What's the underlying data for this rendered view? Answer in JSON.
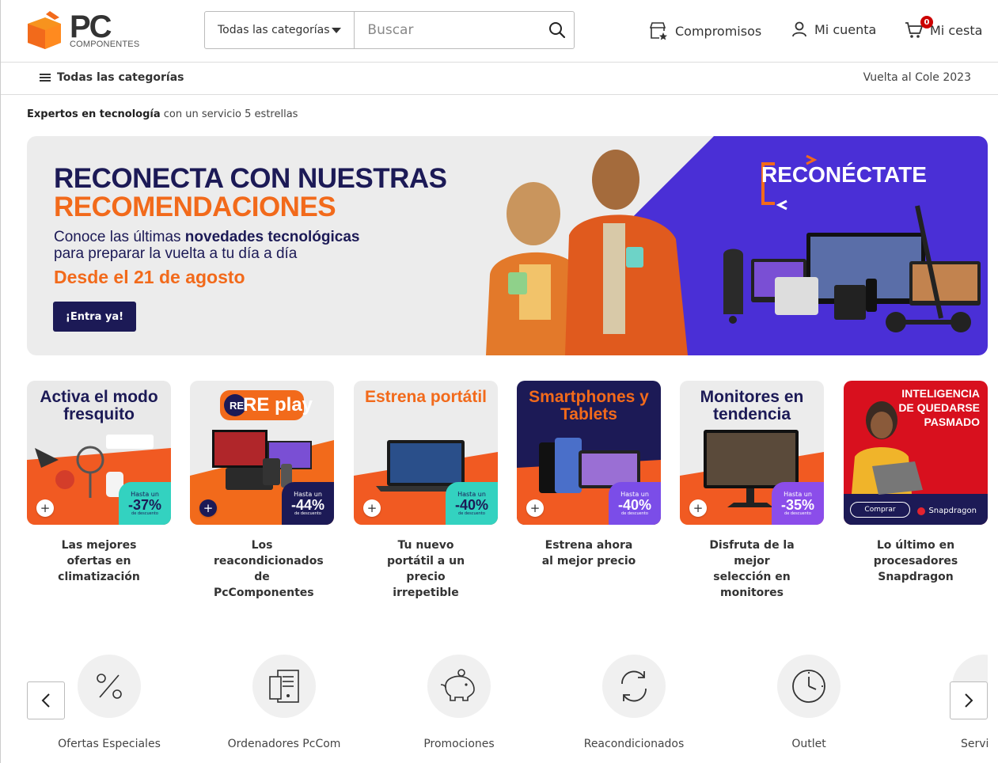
{
  "header": {
    "logo_text": "PC",
    "logo_sub": "COMPONENTES",
    "category_select": "Todas las categorías",
    "search_placeholder": "Buscar",
    "links": {
      "compromisos": "Compromisos",
      "account": "Mi cuenta",
      "cart": "Mi cesta"
    },
    "cart_count": "0"
  },
  "nav": {
    "all_categories": "Todas las categorías",
    "promo_link": "Vuelta al Cole 2023"
  },
  "tagline": {
    "bold": "Expertos en tecnología",
    "rest": " con un servicio 5 estrellas"
  },
  "hero": {
    "line1": "RECONECTA CON NUESTRAS",
    "line2": "RECOMENDACIONES",
    "subtitle_pre": "Conoce las últimas ",
    "subtitle_bold": "novedades tecnológicas",
    "subtitle_post": "para preparar la vuelta a tu día a día",
    "date": "Desde el 21 de agosto",
    "button": "¡Entra ya!",
    "campaign_logo": "RECONÉCTATE",
    "colors": {
      "navy": "#1c1a56",
      "orange": "#f26a1b",
      "purple": "#4a2fd6"
    }
  },
  "cards": [
    {
      "title": "Activa el modo fresquito",
      "caption": "Las mejores ofertas en climatización",
      "badge_small": "Hasta un",
      "badge_big": "-37%",
      "badge_tiny": "de descuento",
      "bg": "#f15a22",
      "top": "#e9e9e9",
      "title_color": "#1c1a56",
      "badge_bg": "#33d2c0",
      "badge_color": "#1c1a56"
    },
    {
      "title": "RE play",
      "caption": "Los reacondicionados de PcComponentes",
      "badge_small": "Hasta un",
      "badge_big": "-44%",
      "badge_tiny": "de descuento",
      "bg": "#ececec",
      "top": "#ececec",
      "title_color": "#f26a1b",
      "badge_bg": "#1c1a56",
      "badge_color": "#ffffff"
    },
    {
      "title": "Estrena portátil",
      "caption": "Tu nuevo portátil a un precio irrepetible",
      "badge_small": "Hasta un",
      "badge_big": "-40%",
      "badge_tiny": "de descuento",
      "bg": "#f15a22",
      "top": "#ececec",
      "title_color": "#f26a1b",
      "badge_bg": "#33d2c0",
      "badge_color": "#1c1a56"
    },
    {
      "title": "Smartphones y Tablets",
      "caption": "Estrena ahora al mejor precio",
      "badge_small": "Hasta un",
      "badge_big": "-40%",
      "badge_tiny": "de descuento",
      "bg": "#1c1a56",
      "top": "#1c1a56",
      "title_color": "#f26a1b",
      "badge_bg": "#7b4de8",
      "badge_color": "#ffffff"
    },
    {
      "title": "Monitores en tendencia",
      "caption": "Disfruta de la mejor selección en monitores",
      "badge_small": "Hasta un",
      "badge_big": "-35%",
      "badge_tiny": "de descuento",
      "bg": "#f15a22",
      "top": "#ececec",
      "title_color": "#1c1a56",
      "badge_bg": "#8b4dea",
      "badge_color": "#ffffff"
    },
    {
      "title": "INTELIGENCIA DE QUEDARSE PASMADO",
      "caption": "Lo último en procesadores Snapdragon",
      "cta": "Comprar",
      "brand": "Snapdragon",
      "bg": "#d8101e",
      "top": "#d8101e",
      "title_color": "#ffffff"
    }
  ],
  "quick_links": [
    {
      "label": "Ofertas Especiales",
      "icon": "percent-icon"
    },
    {
      "label": "Ordenadores PcCom",
      "icon": "desktop-tower-icon"
    },
    {
      "label": "Promociones",
      "icon": "piggy-bank-icon"
    },
    {
      "label": "Reacondicionados",
      "icon": "refresh-icon"
    },
    {
      "label": "Outlet",
      "icon": "clock-icon"
    },
    {
      "label": "Servi",
      "icon": "service-icon"
    }
  ]
}
